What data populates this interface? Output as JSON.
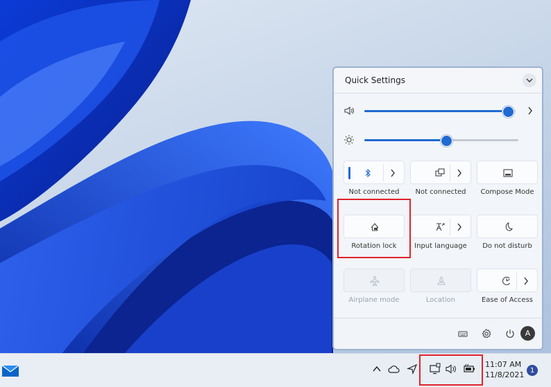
{
  "quick_settings": {
    "title": "Quick Settings",
    "volume_level": 0.95,
    "brightness_level": 0.53,
    "tiles": [
      {
        "label": "Not connected",
        "icon": "bluetooth-icon",
        "has_chevron": true,
        "active": true,
        "disabled": false
      },
      {
        "label": "Not connected",
        "icon": "project-icon",
        "has_chevron": true,
        "active": false,
        "disabled": false
      },
      {
        "label": "Compose Mode",
        "icon": "compose-icon",
        "has_chevron": false,
        "active": false,
        "disabled": false
      },
      {
        "label": "Rotation lock",
        "icon": "rotation-lock-icon",
        "has_chevron": false,
        "active": false,
        "disabled": false
      },
      {
        "label": "Input language",
        "icon": "input-language-icon",
        "has_chevron": true,
        "active": false,
        "disabled": false
      },
      {
        "label": "Do not disturb",
        "icon": "moon-icon",
        "has_chevron": false,
        "active": false,
        "disabled": false
      },
      {
        "label": "Airplane mode",
        "icon": "airplane-icon",
        "has_chevron": false,
        "active": false,
        "disabled": true
      },
      {
        "label": "Location",
        "icon": "location-icon",
        "has_chevron": false,
        "active": false,
        "disabled": true
      },
      {
        "label": "Ease of Access",
        "icon": "accessibility-icon",
        "has_chevron": true,
        "active": false,
        "disabled": false
      }
    ],
    "user_initial": "A"
  },
  "taskbar": {
    "time": "11:07 AM",
    "date": "11/8/2021",
    "notification_count": "1"
  },
  "colors": {
    "accent": "#1f6ad1",
    "highlight": "#e0222b"
  }
}
